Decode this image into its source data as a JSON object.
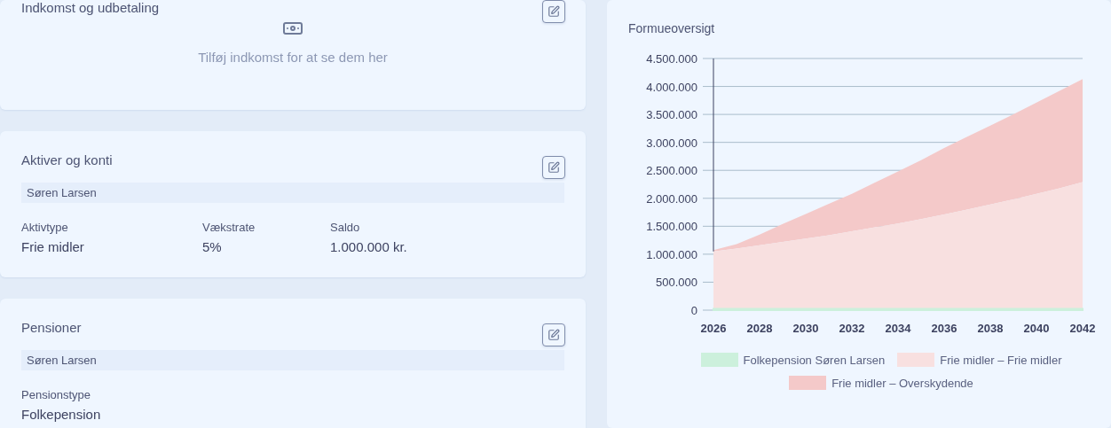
{
  "income": {
    "title": "Indkomst og udbetaling",
    "empty_text": "Tilføj indkomst for at se dem her"
  },
  "assets": {
    "title": "Aktiver og konti",
    "person": "Søren Larsen",
    "fields": [
      {
        "label": "Aktivtype",
        "value": "Frie midler"
      },
      {
        "label": "Vækstrate",
        "value": "5%"
      },
      {
        "label": "Saldo",
        "value": "1.000.000 kr."
      }
    ]
  },
  "pensions": {
    "title": "Pensioner",
    "person": "Søren Larsen",
    "fields": [
      {
        "label": "Pensionstype",
        "value": "Folkepension"
      }
    ]
  },
  "overview": {
    "title": "Formueoversigt",
    "chart_data": {
      "type": "area",
      "stacked": true,
      "x": [
        2026,
        2027,
        2028,
        2029,
        2030,
        2031,
        2032,
        2033,
        2034,
        2035,
        2036,
        2037,
        2038,
        2039,
        2040,
        2041,
        2042
      ],
      "xticks": [
        2026,
        2028,
        2030,
        2032,
        2034,
        2036,
        2038,
        2040,
        2042
      ],
      "xlim": [
        2026,
        2042
      ],
      "ylim": [
        0,
        4500000
      ],
      "grid": true,
      "yticks": [
        {
          "value": 0,
          "label": "0"
        },
        {
          "value": 500000,
          "label": "500.000"
        },
        {
          "value": 1000000,
          "label": "1.000.000"
        },
        {
          "value": 1500000,
          "label": "1.500.000"
        },
        {
          "value": 2000000,
          "label": "2.000.000"
        },
        {
          "value": 2500000,
          "label": "2.500.000"
        },
        {
          "value": 3000000,
          "label": "3.000.000"
        },
        {
          "value": 3500000,
          "label": "3.500.000"
        },
        {
          "value": 4000000,
          "label": "4.000.000"
        },
        {
          "value": 4500000,
          "label": "4.500.000"
        }
      ],
      "series": [
        {
          "name": "Folkepension Søren Larsen",
          "color": "#ccf0dc",
          "values": [
            0,
            0,
            0,
            0,
            0,
            0,
            0,
            0,
            0,
            0,
            0,
            0,
            0,
            0,
            0,
            0,
            0
          ]
        },
        {
          "name": "Frie midler – Frie midler",
          "color": "#f8e0e0",
          "values": [
            1050000,
            1100000,
            1160000,
            1220000,
            1280000,
            1340000,
            1410000,
            1480000,
            1550000,
            1630000,
            1710000,
            1800000,
            1890000,
            1980000,
            2080000,
            2180000,
            2290000
          ]
        },
        {
          "name": "Frie midler – Overskydende",
          "color": "#f4c9c9",
          "values": [
            0,
            80000,
            190000,
            320000,
            440000,
            560000,
            670000,
            800000,
            930000,
            1050000,
            1190000,
            1300000,
            1410000,
            1520000,
            1630000,
            1740000,
            1840000
          ]
        }
      ]
    }
  }
}
